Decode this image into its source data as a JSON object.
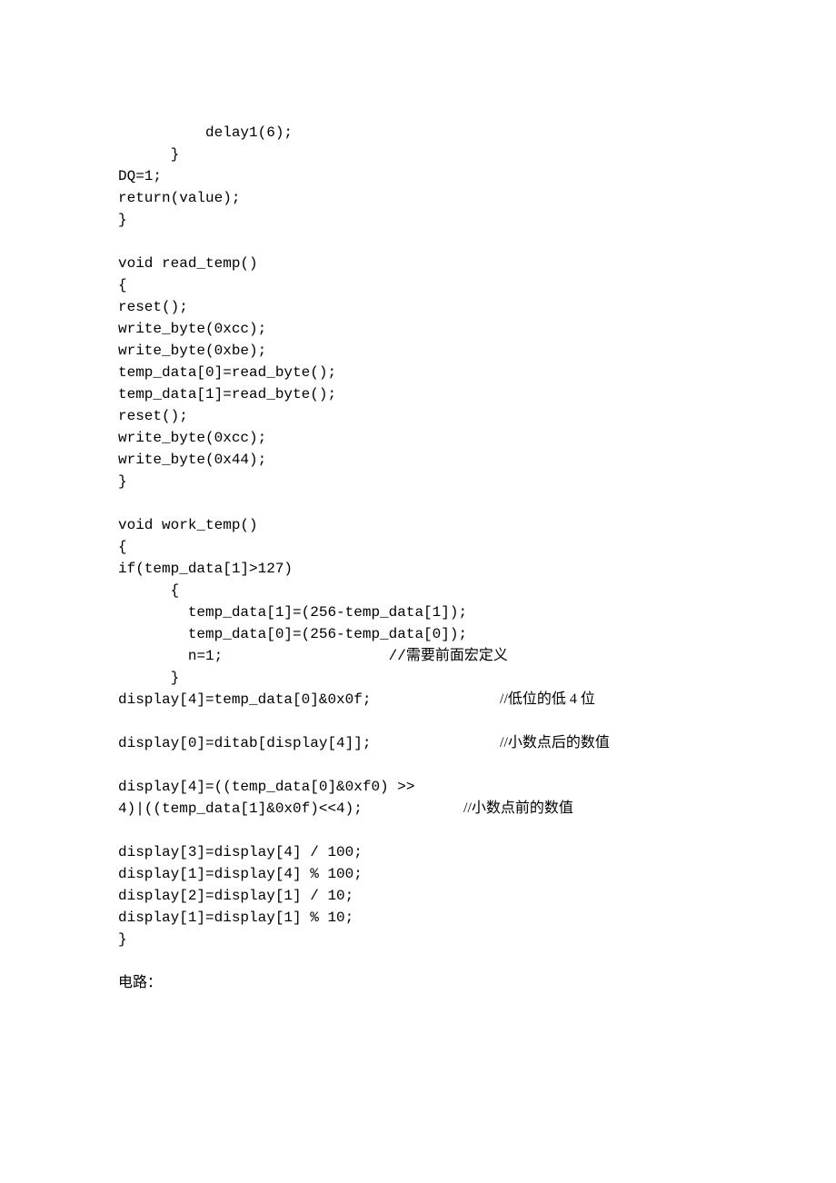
{
  "code": {
    "l1": "          delay1(6);",
    "l2": "      }",
    "l3": "DQ=1;",
    "l4": "return(value);",
    "l5": "}",
    "l6": "",
    "l7": "void read_temp()",
    "l8": "{",
    "l9": "reset();",
    "l10": "write_byte(0xcc);",
    "l11": "write_byte(0xbe);",
    "l12": "temp_data[0]=read_byte();",
    "l13": "temp_data[1]=read_byte();",
    "l14": "reset();",
    "l15": "write_byte(0xcc);",
    "l16": "write_byte(0x44);",
    "l17": "}",
    "l18": "",
    "l19": "void work_temp()",
    "l20": "{",
    "l21": "if(temp_data[1]>127)",
    "l22": "      {",
    "l23": "        temp_data[1]=(256-temp_data[1]);",
    "l24": "        temp_data[0]=(256-temp_data[0]);",
    "l25a": "        n=1;                   //",
    "l25b": "需要前面宏定义",
    "l26": "      }",
    "l27a": "display[4]=temp_data[0]&0x0f;",
    "l27b": "//低位的低 4 位",
    "l28a": "display[0]=ditab[display[4]];",
    "l28b": "//小数点后的数值",
    "l29": "display[4]=((temp_data[0]&0xf0) >>",
    "l30a": "4)|((temp_data[1]&0x0f)<<4);",
    "l30b": "//小数点前的数值",
    "l31": "display[3]=display[4] / 100;",
    "l32": "display[1]=display[4] % 100;",
    "l33": "display[2]=display[1] / 10;",
    "l34": "display[1]=display[1] % 10;",
    "l35": "}"
  },
  "footer": "电路："
}
